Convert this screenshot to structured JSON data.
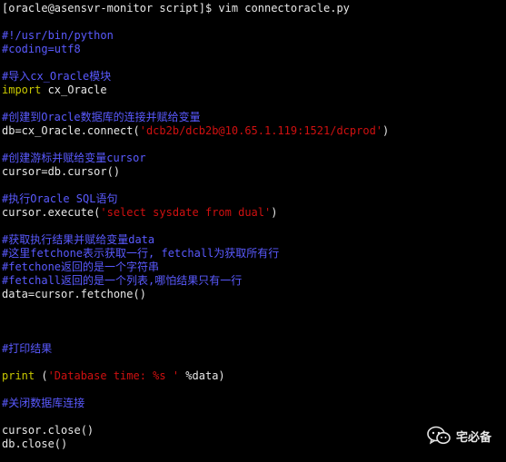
{
  "terminal": {
    "prompt": "[oracle@asensvr-monitor script]$ vim connectoracle.py",
    "lines": {
      "shebang": "#!/usr/bin/python",
      "coding": "#coding=utf8",
      "c_import": "#导入cx_Oracle模块",
      "import_kw": "import",
      "import_rest": " cx_Oracle",
      "c_connect": "#创建到Oracle数据库的连接并赋给变量",
      "connect_pre": "db=cx_Oracle.connect(",
      "connect_str": "'dcb2b/dcb2b@10.65.1.119:1521/dcprod'",
      "connect_post": ")",
      "c_cursor": "#创建游标并赋给变量cursor",
      "cursor_line": "cursor=db.cursor()",
      "c_execute": "#执行Oracle SQL语句",
      "execute_pre": "cursor.execute(",
      "execute_str": "'select sysdate from dual'",
      "execute_post": ")",
      "c_fetch1": "#获取执行结果并赋给变量data",
      "c_fetch2": "#这里fetchone表示获取一行, fetchall为获取所有行",
      "c_fetch3": "#fetchone返回的是一个字符串",
      "c_fetch4": "#fetchall返回的是一个列表,哪怕结果只有一行",
      "fetch_line": "data=cursor.fetchone()",
      "c_print": "#打印结果",
      "print_kw": "print",
      "print_pre": " (",
      "print_str": "'Database time: %s '",
      "print_post": " %data)",
      "c_close": "#关闭数据库连接",
      "close_cursor": "cursor.close()",
      "close_db": "db.close()"
    }
  },
  "watermark": {
    "label": "宅必备",
    "icon": "wechat-icon"
  },
  "colors": {
    "background": "#000000",
    "text": "#e8e8e8",
    "comment": "#5a5aff",
    "keyword": "#c8c800",
    "string": "#d01010"
  }
}
